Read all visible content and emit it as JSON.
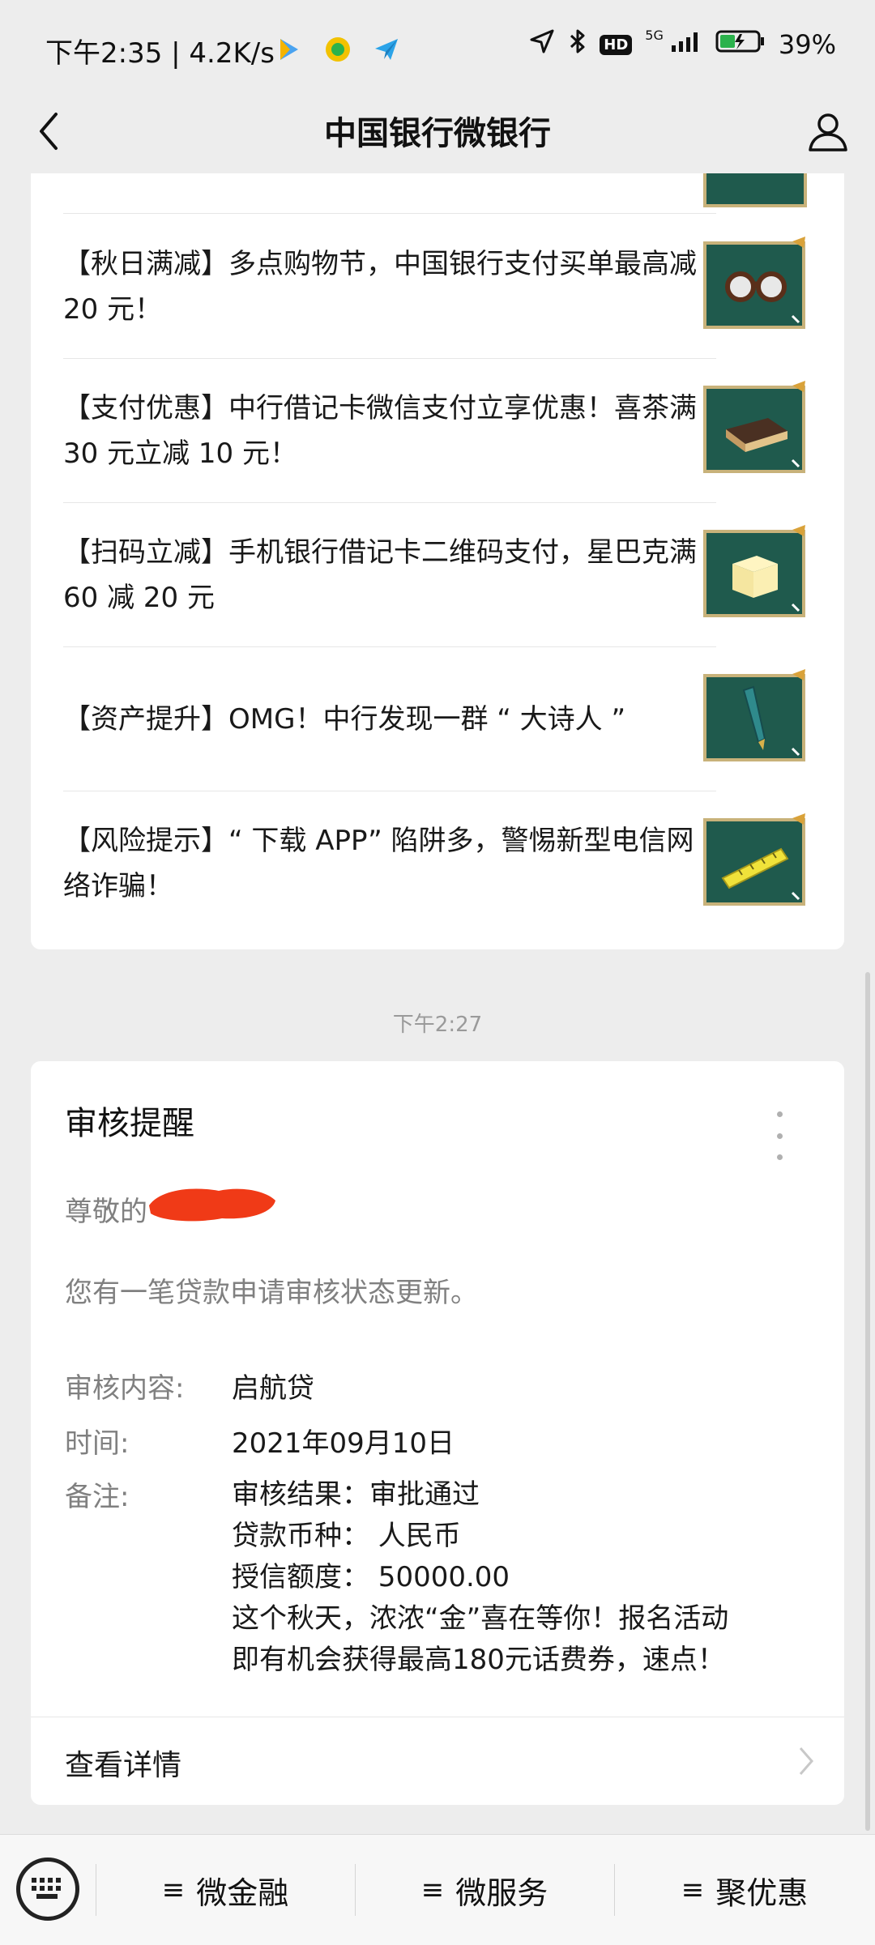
{
  "status_bar": {
    "time_speed": "下午2:35 | 4.2K/s",
    "hd_label": "HD",
    "network_label": "5G",
    "battery": "39%"
  },
  "header": {
    "title": "中国银行微银行"
  },
  "articles": [
    {
      "text": "【秋日满减】多点购物节，中国银行支付买单最高减 20 元！",
      "icon": "glasses-icon"
    },
    {
      "text": "【支付优惠】中行借记卡微信支付立享优惠！喜茶满 30 元立减 10 元！",
      "icon": "cake-box-icon"
    },
    {
      "text": "【扫码立减】手机银行借记卡二维码支付，星巴克满 60 减 20 元",
      "icon": "sticky-notes-icon"
    },
    {
      "text": "【资产提升】OMG！中行发现一群 “ 大诗人 ”",
      "icon": "fountain-pen-icon"
    },
    {
      "text": "【风险提示】“ 下载 APP” 陷阱多，警惕新型电信网络诈骗！",
      "icon": "ruler-icon"
    }
  ],
  "timestamp": "下午2:27",
  "notice": {
    "title": "审核提醒",
    "greeting": "尊敬的",
    "intro": "您有一笔贷款申请审核状态更新。",
    "content_label": "审核内容:",
    "content_value": "启航贷",
    "time_label": "时间:",
    "time_value": "2021年09月10日",
    "remark_label": "备注:",
    "remark_lines": [
      "审核结果：审批通过",
      "贷款币种： 人民币",
      "授信额度： 50000.00",
      "这个秋天，浓浓“金”喜在等你！报名活动",
      "即有机会获得最高180元话费券，速点！"
    ],
    "detail_label": "查看详情"
  },
  "bottom_menu": [
    {
      "label": "微金融",
      "icon": "≡"
    },
    {
      "label": "微服务",
      "icon": "≡"
    },
    {
      "label": "聚优惠",
      "icon": "≡"
    }
  ],
  "colors": {
    "page_bg": "#ededed",
    "thumb_board": "#1f5a4d",
    "thumb_frame": "#c8b27a",
    "redaction": "#f03a17"
  }
}
